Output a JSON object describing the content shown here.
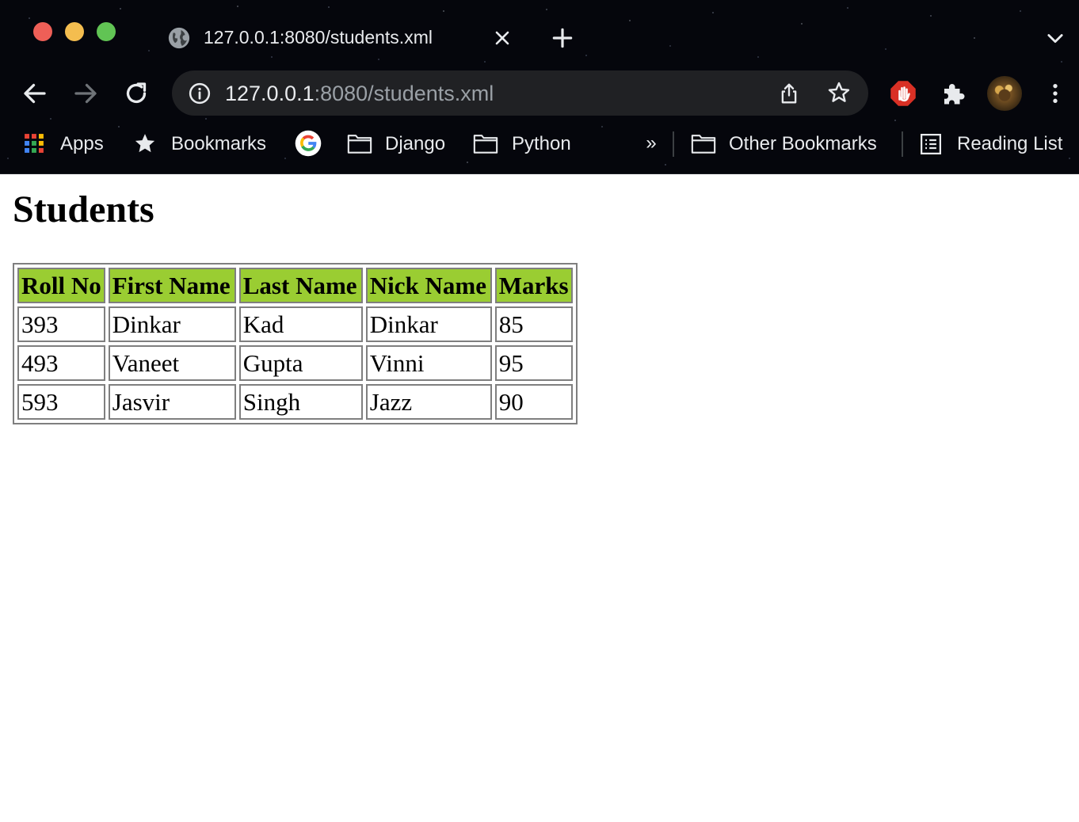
{
  "browser": {
    "tab": {
      "title": "127.0.0.1:8080/students.xml",
      "icon": "globe-icon"
    },
    "address": {
      "host": "127.0.0.1",
      "path": ":8080/students.xml"
    },
    "bookmarks": {
      "items": [
        {
          "label": "Apps",
          "icon": "apps-grid-icon"
        },
        {
          "label": "Bookmarks",
          "icon": "star-icon"
        },
        {
          "label": "",
          "icon": "google-icon"
        },
        {
          "label": "Django",
          "icon": "folder-icon"
        },
        {
          "label": "Python",
          "icon": "folder-icon"
        }
      ],
      "overflow": "»",
      "other_label": "Other Bookmarks",
      "reading_list_label": "Reading List"
    },
    "colors": {
      "chrome_bg": "#05060c",
      "omnibox_bg": "#202124",
      "text": "#e8eaed",
      "muted_text": "#9aa0a6"
    }
  },
  "page": {
    "title": "Students",
    "table": {
      "header_color": "#9acd32",
      "columns": [
        "Roll No",
        "First Name",
        "Last Name",
        "Nick Name",
        "Marks"
      ],
      "rows": [
        [
          "393",
          "Dinkar",
          "Kad",
          "Dinkar",
          "85"
        ],
        [
          "493",
          "Vaneet",
          "Gupta",
          "Vinni",
          "95"
        ],
        [
          "593",
          "Jasvir",
          "Singh",
          "Jazz",
          "90"
        ]
      ]
    }
  }
}
